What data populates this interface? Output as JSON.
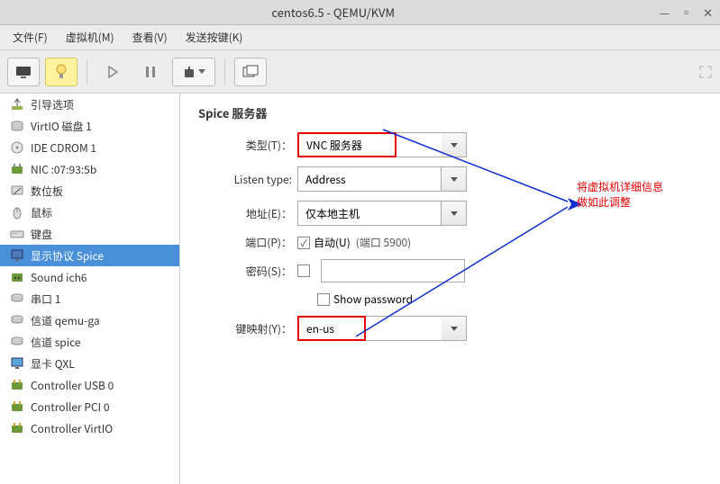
{
  "window": {
    "title": "centos6.5 - QEMU/KVM"
  },
  "menu": {
    "file": "文件(F)",
    "vm": "虚拟机(M)",
    "view": "查看(V)",
    "send_keys": "发送按键(K)"
  },
  "sidebar": {
    "items": [
      {
        "label": "引导选项",
        "icon": "boot"
      },
      {
        "label": "VirtIO 磁盘 1",
        "icon": "disk"
      },
      {
        "label": "IDE CDROM 1",
        "icon": "cdrom"
      },
      {
        "label": "NIC :07:93:5b",
        "icon": "nic"
      },
      {
        "label": "数位板",
        "icon": "tablet"
      },
      {
        "label": "鼠标",
        "icon": "mouse"
      },
      {
        "label": "键盘",
        "icon": "keyboard"
      },
      {
        "label": "显示协议 Spice",
        "icon": "display",
        "selected": true
      },
      {
        "label": "Sound ich6",
        "icon": "sound"
      },
      {
        "label": "串口 1",
        "icon": "serial"
      },
      {
        "label": "信道 qemu-ga",
        "icon": "channel"
      },
      {
        "label": "信道 spice",
        "icon": "channel"
      },
      {
        "label": "显卡 QXL",
        "icon": "video"
      },
      {
        "label": "Controller USB 0",
        "icon": "controller"
      },
      {
        "label": "Controller PCI 0",
        "icon": "controller"
      },
      {
        "label": "Controller VirtIO",
        "icon": "controller"
      }
    ]
  },
  "main": {
    "section_title": "Spice 服务器",
    "type_label": "类型(T)：",
    "type_value": "VNC 服务器",
    "listen_type_label": "Listen type:",
    "listen_type_value": "Address",
    "address_label": "地址(E)：",
    "address_value": "仅本地主机",
    "port_label": "端口(P)：",
    "port_auto_label": "自动(U)",
    "port_value": "(端口 5900)",
    "password_label": "密码(S)：",
    "show_password_label": "Show password",
    "keymap_label": "键映射(Y)：",
    "keymap_value": "en-us"
  },
  "annotation": {
    "line1": "将虚拟机详细信息",
    "line2": "做如此调整"
  }
}
